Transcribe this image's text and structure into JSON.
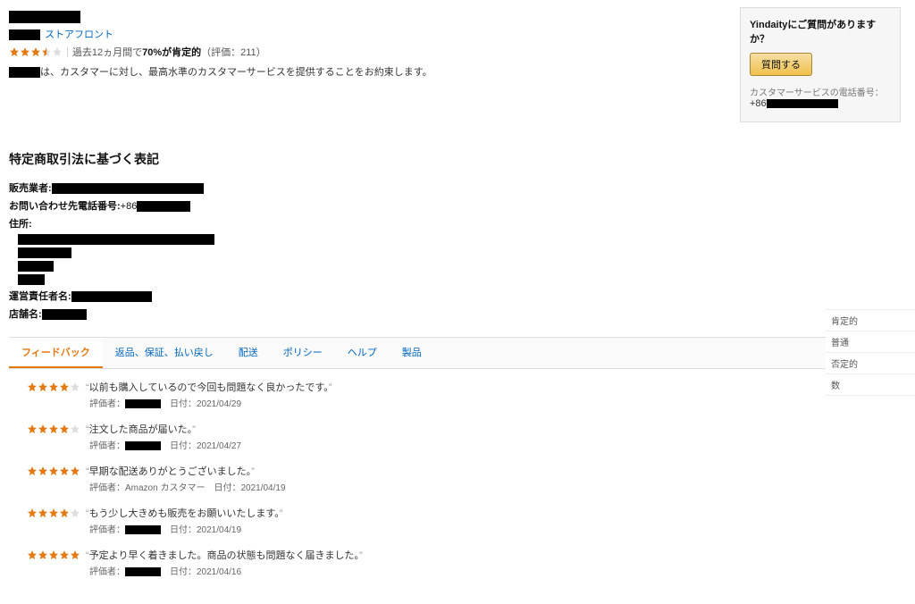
{
  "header": {
    "storefront_link": "ストアフロント",
    "rating_prefix": "過去12ヵ月間で",
    "rating_percent": "70%が肯定的",
    "rating_count_label": "（評価：211）",
    "promise_suffix": "は、カスタマーに対し、最高水準のカスタマーサービスを提供することをお約束します。",
    "stars_value": 3.5
  },
  "qa": {
    "title": "Yindaityにご質問がありますか？",
    "ask_label": "質問する",
    "phone_label": "カスタマーサービスの電話番号：",
    "phone_prefix": "+86"
  },
  "legal": {
    "title": "特定商取引法に基づく表記",
    "seller_label": "販売業者:",
    "phone_label": "お問い合わせ先電話番号:",
    "phone_prefix": "+86",
    "address_label": "住所:",
    "responsible_label": "運営責任者名:",
    "store_label": "店舗名:"
  },
  "tabs": [
    {
      "label": "フィードバック",
      "active": true
    },
    {
      "label": "返品、保証、払い戻し",
      "active": false
    },
    {
      "label": "配送",
      "active": false
    },
    {
      "label": "ポリシー",
      "active": false
    },
    {
      "label": "ヘルプ",
      "active": false
    },
    {
      "label": "製品",
      "active": false
    }
  ],
  "feedback_labels": {
    "rater": "評価者：",
    "date": "日付："
  },
  "feedback": [
    {
      "stars": 4,
      "text": "以前も購入しているので今回も問題なく良かったです。",
      "rater": "REDACTED",
      "date": "2021/04/29"
    },
    {
      "stars": 4,
      "text": "注文した商品が届いた。",
      "rater": "REDACTED",
      "date": "2021/04/27"
    },
    {
      "stars": 5,
      "text": "早期な配送ありがとうございました。",
      "rater": "Amazon カスタマー",
      "date": "2021/04/19"
    },
    {
      "stars": 4,
      "text": "もう少し大きめも販売をお願いいたします。",
      "rater": "REDACTED",
      "date": "2021/04/19"
    },
    {
      "stars": 5,
      "text": "予定より早く着きました。商品の状態も問題なく届きました。",
      "rater": "REDACTED",
      "date": "2021/04/16"
    }
  ],
  "summary": {
    "rows": [
      "肯定的",
      "普通",
      "否定的",
      "数"
    ]
  }
}
